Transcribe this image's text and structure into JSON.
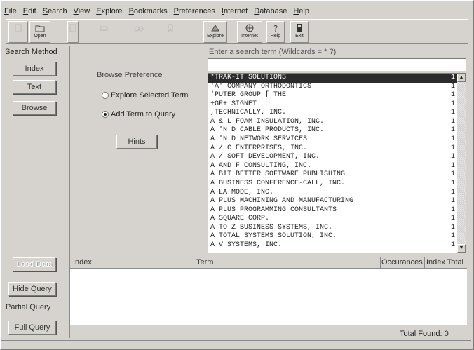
{
  "menu": [
    "File",
    "Edit",
    "Search",
    "View",
    "Explore",
    "Bookmarks",
    "Preferences",
    "Internet",
    "Database",
    "Help"
  ],
  "toolbar": {
    "buttons": [
      {
        "label": "",
        "icon": "new-icon",
        "enabled": false
      },
      {
        "label": "Open",
        "icon": "open-folder-icon",
        "enabled": true
      },
      {
        "label": "",
        "icon": "save-icon",
        "enabled": false
      },
      {
        "label": "",
        "icon": "print-icon",
        "enabled": false
      },
      {
        "label": "",
        "icon": "binoculars-icon",
        "enabled": false
      },
      {
        "label": "",
        "icon": "bookmark-icon",
        "enabled": false
      },
      {
        "label": "Explore",
        "icon": "explore-icon",
        "enabled": true
      },
      {
        "label": "Internet",
        "icon": "globe-icon",
        "enabled": true
      },
      {
        "label": "Help",
        "icon": "help-icon",
        "enabled": true
      },
      {
        "label": "Exit",
        "icon": "exit-icon",
        "enabled": true
      }
    ]
  },
  "left": {
    "title": "Search Method",
    "buttons": [
      "Index",
      "Text",
      "Browse"
    ],
    "bottom_buttons": [
      "Hide Query",
      "Partial Query",
      "Full Query"
    ],
    "disabled_button": "Load Data"
  },
  "browse": {
    "title": "Browse Preference",
    "options": [
      "Explore Selected Term",
      "Add Term to Query"
    ],
    "selected_index": 1,
    "hints_label": "Hints"
  },
  "search": {
    "label": "Enter a search term  (Wildcards = * ?)",
    "value": ""
  },
  "results": [
    {
      "term": "*TRAK-IT SOLUTIONS",
      "count": "1"
    },
    {
      "term": "'A' COMPANY ORTHODONTICS",
      "count": "1"
    },
    {
      "term": "'PUTER GROUP [ THE",
      "count": "1"
    },
    {
      "term": "+GF+ SIGNET",
      "count": "1"
    },
    {
      "term": ",TECHNICALLY, INC.",
      "count": "1"
    },
    {
      "term": "A & L FOAM INSULATION, INC.",
      "count": "1"
    },
    {
      "term": "A 'N D CABLE PRODUCTS, INC.",
      "count": "1"
    },
    {
      "term": "A 'N D NETWORK SERVICES",
      "count": "1"
    },
    {
      "term": "A / C ENTERPRISES, INC.",
      "count": "1"
    },
    {
      "term": "A / SOFT DEVELOPMENT, INC.",
      "count": "1"
    },
    {
      "term": "A AND F CONSULTING, INC.",
      "count": "1"
    },
    {
      "term": "A BIT BETTER SOFTWARE PUBLISHING",
      "count": "1"
    },
    {
      "term": "A BUSINESS CONFERENCE-CALL, INC.",
      "count": "1"
    },
    {
      "term": "A LA MODE, INC.",
      "count": "1"
    },
    {
      "term": "A PLUS MACHINING AND MANUFACTURING",
      "count": "1"
    },
    {
      "term": "A PLUS PROGRAMMING CONSULTANTS",
      "count": "1"
    },
    {
      "term": "A SQUARE CORP.",
      "count": "1"
    },
    {
      "term": "A TO Z BUSINESS SYSTEMS, INC.",
      "count": "1"
    },
    {
      "term": "A TOTAL SYSTEMS SOLUTION, INC.",
      "count": "1"
    },
    {
      "term": "A V SYSTEMS, INC.",
      "count": "1"
    }
  ],
  "selected_row": 0,
  "grid": {
    "headers": [
      "Index",
      "Term",
      "Occurances",
      "Index Total"
    ]
  },
  "status": {
    "total_found": "Total Found: 0"
  }
}
